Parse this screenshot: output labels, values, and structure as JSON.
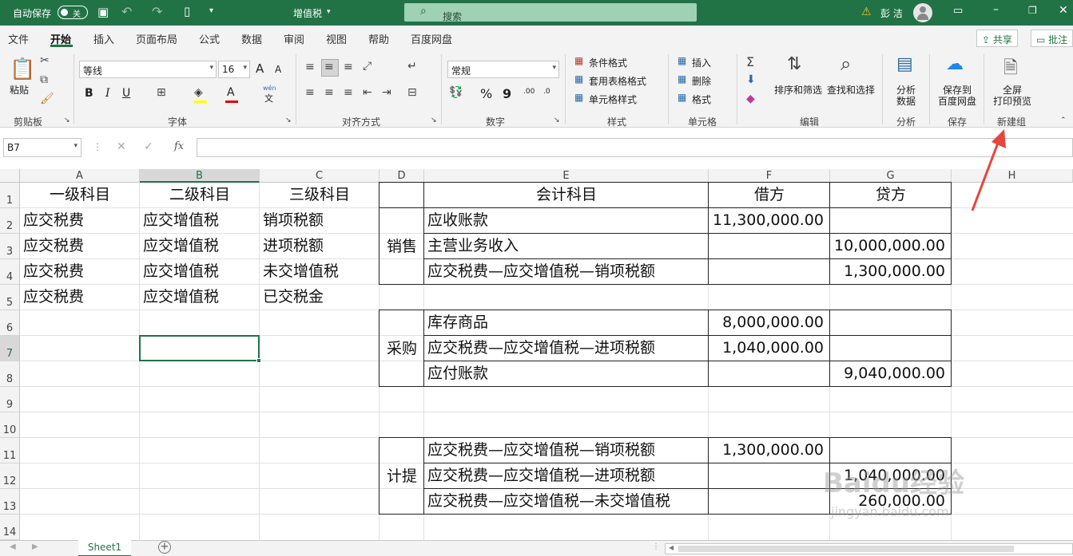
{
  "titlebar": {
    "autosave_label": "自动保存",
    "autosave_state": "关",
    "filename": "增值税",
    "search_placeholder": "搜索",
    "user_name": "彭 洁"
  },
  "menu": {
    "tabs": [
      "文件",
      "开始",
      "插入",
      "页面布局",
      "公式",
      "数据",
      "审阅",
      "视图",
      "帮助",
      "百度网盘"
    ],
    "active_tab": "开始",
    "share_label": "共享",
    "comment_label": "批注"
  },
  "ribbon": {
    "clipboard": {
      "paste": "粘贴",
      "group": "剪贴板"
    },
    "font": {
      "name": "等线",
      "size": "16",
      "bold": "B",
      "italic": "I",
      "underline": "U",
      "group": "字体",
      "grow": "A",
      "shrink": "A",
      "phonetic_top": "wén",
      "phonetic_bottom": "文"
    },
    "alignment": {
      "group": "对齐方式"
    },
    "number": {
      "format": "常规",
      "percent": "%",
      "comma": "9",
      "inc": ".00",
      "dec": ".0",
      "group": "数字"
    },
    "styles": {
      "conditional": "条件格式",
      "table": "套用表格格式",
      "cell": "单元格样式",
      "group": "样式"
    },
    "cells": {
      "insert": "插入",
      "delete": "删除",
      "format": "格式",
      "group": "单元格"
    },
    "editing": {
      "sort": "排序和筛选",
      "find": "查找和选择",
      "group": "编辑"
    },
    "analysis": {
      "analyze_1": "分析",
      "analyze_2": "数据",
      "group": "分析"
    },
    "save": {
      "save_1": "保存到",
      "save_2": "百度网盘",
      "group": "保存"
    },
    "newgroup": {
      "print_1": "全屏",
      "print_2": "打印预览",
      "group": "新建组"
    }
  },
  "formula_bar": {
    "name_box": "B7",
    "fx": "fx",
    "value": ""
  },
  "columns": [
    "A",
    "B",
    "C",
    "D",
    "E",
    "F",
    "G",
    "H"
  ],
  "rows": [
    "1",
    "2",
    "3",
    "4",
    "5",
    "6",
    "7",
    "8",
    "9",
    "10",
    "11",
    "12",
    "13",
    "14"
  ],
  "table_left": {
    "headers": [
      "一级科目",
      "二级科目",
      "三级科目"
    ],
    "rows": [
      [
        "应交税费",
        "应交增值税",
        "销项税额"
      ],
      [
        "应交税费",
        "应交增值税",
        "进项税额"
      ],
      [
        "应交税费",
        "应交增值税",
        "未交增值税"
      ],
      [
        "应交税费",
        "应交增值税",
        "已交税金"
      ]
    ]
  },
  "table_right": {
    "headers": [
      "会计科目",
      "借方",
      "贷方"
    ],
    "sections": [
      {
        "label": "销售",
        "entries": [
          [
            "应收账款",
            "11,300,000.00",
            ""
          ],
          [
            "主营业务收入",
            "",
            "10,000,000.00"
          ],
          [
            "应交税费—应交增值税—销项税额",
            "",
            "1,300,000.00"
          ]
        ]
      },
      {
        "label": "采购",
        "entries": [
          [
            "库存商品",
            "8,000,000.00",
            ""
          ],
          [
            "应交税费—应交增值税—进项税额",
            "1,040,000.00",
            ""
          ],
          [
            "应付账款",
            "",
            "9,040,000.00"
          ]
        ]
      },
      {
        "label": "计提",
        "entries": [
          [
            "应交税费—应交增值税—销项税额",
            "1,300,000.00",
            ""
          ],
          [
            "应交税费—应交增值税—进项税额",
            "",
            "1,040,000.00"
          ],
          [
            "应交税费—应交增值税—未交增值税",
            "",
            "260,000.00"
          ]
        ]
      }
    ]
  },
  "sheets": {
    "active": "Sheet1",
    "add": "+"
  },
  "watermark": {
    "main": "Baidu经验",
    "sub": "jingyan.baidu.com"
  }
}
